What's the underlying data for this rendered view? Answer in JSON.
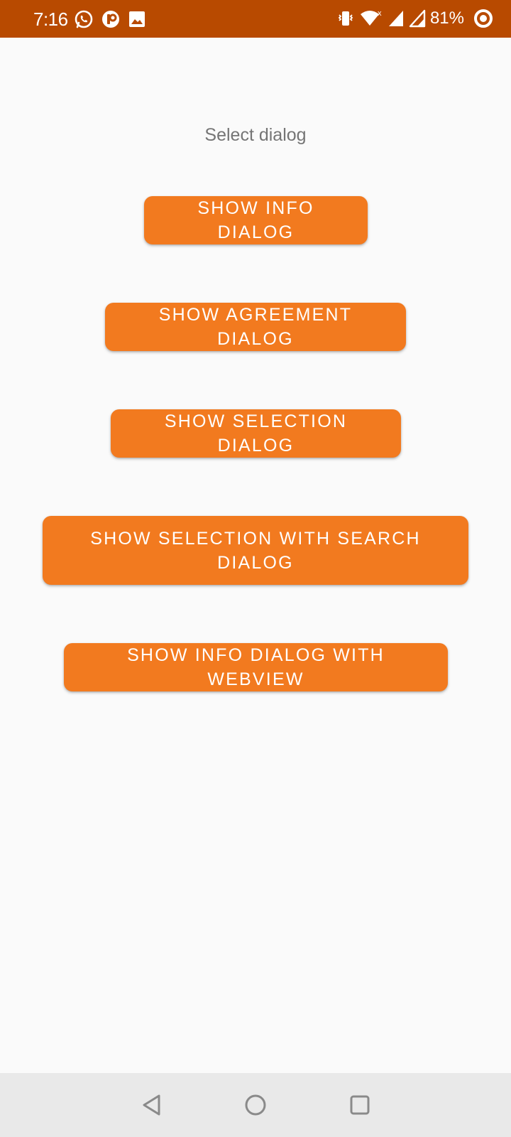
{
  "status_bar": {
    "time": "7:16",
    "battery_percent": "81%",
    "left_icons": [
      "whatsapp-icon",
      "app-notification-icon",
      "image-icon"
    ],
    "right_icons": [
      "vibrate-icon",
      "wifi-icon",
      "signal-icon",
      "signal-icon",
      "battery-ring-icon"
    ],
    "background_color": "#b84a00"
  },
  "page": {
    "title": "Select dialog"
  },
  "buttons": {
    "info": "SHOW INFO DIALOG",
    "agreement": "SHOW AGREEMENT DIALOG",
    "selection": "SHOW SELECTION DIALOG",
    "selection_search": "SHOW SELECTION WITH SEARCH DIALOG",
    "info_webview": "SHOW INFO DIALOG WITH WEBVIEW",
    "color": "#f27a1f"
  },
  "nav_bar": {
    "icons": [
      "back-icon",
      "home-icon",
      "recents-icon"
    ]
  }
}
